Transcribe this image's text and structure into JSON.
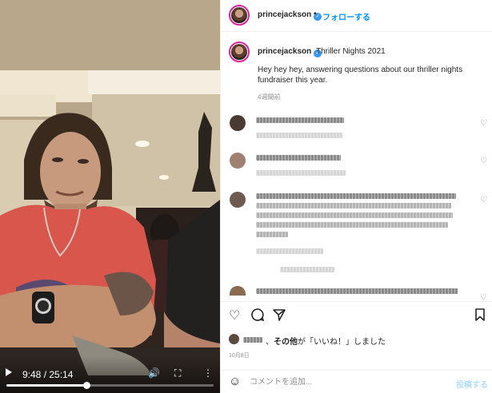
{
  "video": {
    "current_time": "9:48",
    "duration": "25:14",
    "time_display": "9:48 / 25:14",
    "progress_fraction": 0.388,
    "play_icon": "play-icon",
    "volume_icon": "volume-icon",
    "fullscreen_icon": "fullscreen-icon",
    "more_icon": "more-vertical-icon"
  },
  "header": {
    "username": "princejackson",
    "verified_icon": "verified-badge-icon",
    "separator": "•",
    "follow_label": "フォローする"
  },
  "caption": {
    "username": "princejackson",
    "title": "Thriller Nights 2021",
    "text": "Hey hey hey, answering questions about our thriller nights fundraiser this year.",
    "time_ago": "4週間前"
  },
  "comments": [
    {
      "pixelated": true,
      "avatar_color": "#4a3a34"
    },
    {
      "pixelated": true,
      "avatar_color": "#a08070"
    },
    {
      "pixelated": true,
      "avatar_color": "#6e5a50"
    },
    {
      "pixelated": true,
      "avatar_color": "#8a6a50"
    }
  ],
  "actions": {
    "like_icon": "heart-icon",
    "comment_icon": "comment-icon",
    "share_icon": "send-icon",
    "save_icon": "bookmark-icon"
  },
  "likes": {
    "others_label": "その他",
    "text_middle": "が「いいね！」しました",
    "separator": "、"
  },
  "post_date": "10月8日",
  "add_comment": {
    "emoji_icon": "smile-icon",
    "placeholder": "コメントを追加...",
    "post_label": "投稿する"
  },
  "colors": {
    "follow_blue": "#0095f6",
    "post_disabled_blue": "#b2dffc",
    "verified_blue": "#3897f0",
    "shirt_red": "#d9564c"
  }
}
